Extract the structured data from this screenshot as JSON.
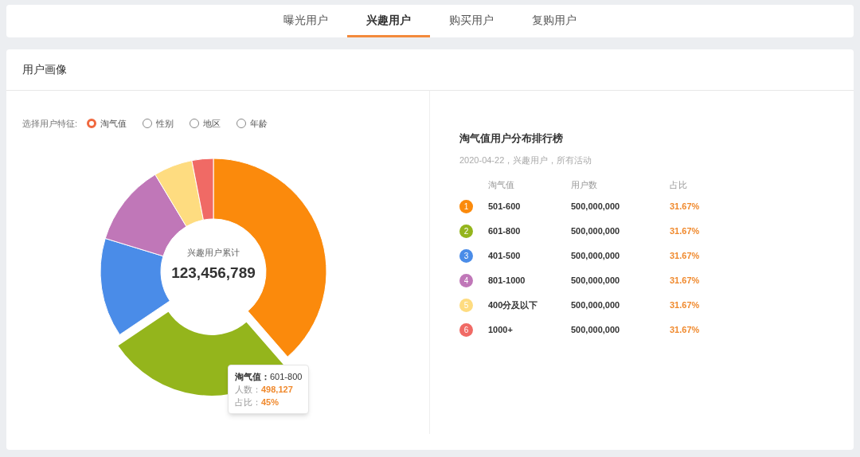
{
  "tabs": [
    {
      "label": "曝光用户",
      "selected": false
    },
    {
      "label": "兴趣用户",
      "selected": true
    },
    {
      "label": "购买用户",
      "selected": false
    },
    {
      "label": "复购用户",
      "selected": false
    }
  ],
  "panel": {
    "title": "用户画像"
  },
  "feature_filter": {
    "label": "选择用户特征:",
    "options": [
      {
        "label": "淘气值",
        "selected": true
      },
      {
        "label": "性别",
        "selected": false
      },
      {
        "label": "地区",
        "selected": false
      },
      {
        "label": "年龄",
        "selected": false
      }
    ]
  },
  "donut": {
    "center_label": "兴趣用户累计",
    "total": "123,456,789",
    "slices": [
      {
        "exploded": false,
        "color": "#fb8a0c"
      },
      {
        "exploded": true,
        "color": "#94b51c"
      },
      {
        "exploded": false,
        "color": "#4a8ce8"
      },
      {
        "exploded": false,
        "color": "#c077b8"
      },
      {
        "exploded": false,
        "color": "#fedc80"
      },
      {
        "exploded": false,
        "color": "#f06a65"
      }
    ],
    "tooltip": {
      "title_label": "淘气值：",
      "title_value": "601-800",
      "rows": [
        {
          "label": "人数：",
          "value": "498,127"
        },
        {
          "label": "占比：",
          "value": "45%"
        }
      ]
    }
  },
  "ranking": {
    "title": "淘气值用户分布排行榜",
    "subtitle": "2020-04-22，兴趣用户，所有活动",
    "columns": [
      "淘气值",
      "用户数",
      "占比"
    ],
    "rows": [
      {
        "rank": "1",
        "range": "501-600",
        "users": "500,000,000",
        "share": "31.67%",
        "color": "#fb8a0c"
      },
      {
        "rank": "2",
        "range": "601-800",
        "users": "500,000,000",
        "share": "31.67%",
        "color": "#94b51c"
      },
      {
        "rank": "3",
        "range": "401-500",
        "users": "500,000,000",
        "share": "31.67%",
        "color": "#4a8ce8"
      },
      {
        "rank": "4",
        "range": "801-1000",
        "users": "500,000,000",
        "share": "31.67%",
        "color": "#c077b8"
      },
      {
        "rank": "5",
        "range": "400分及以下",
        "users": "500,000,000",
        "share": "31.67%",
        "color": "#fedc80"
      },
      {
        "rank": "6",
        "range": "1000+",
        "users": "500,000,000",
        "share": "31.67%",
        "color": "#f06a65"
      }
    ]
  }
}
